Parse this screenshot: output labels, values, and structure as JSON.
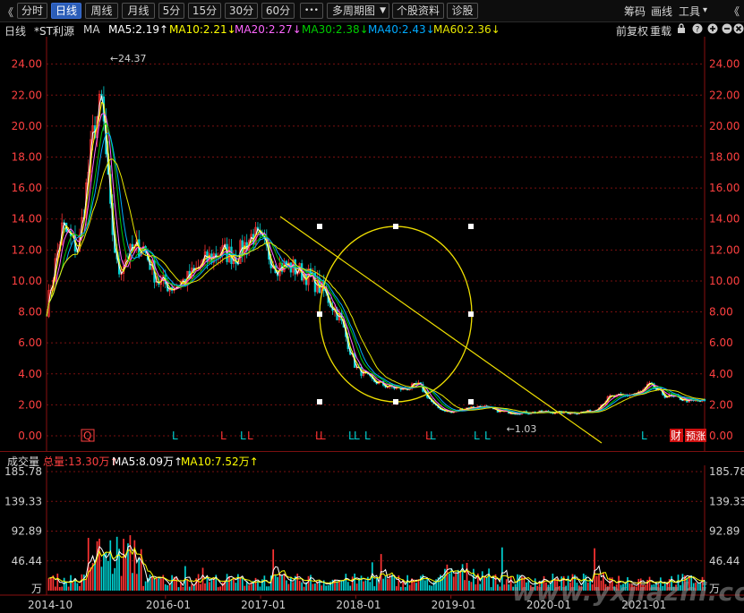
{
  "toolbar": {
    "back_glyph": "《",
    "tabs": [
      "分时",
      "日线",
      "周线",
      "月线",
      "5分",
      "15分",
      "30分",
      "60分"
    ],
    "active_tab": "日线",
    "more_glyph": "•••",
    "multi_period": "多周期图",
    "stock_info": "个股资料",
    "diagnose": "诊股",
    "chips": "筹码",
    "draw": "画线",
    "tools": "工具",
    "tools_caret": "▾",
    "collapse_glyph": "《"
  },
  "info": {
    "period": "日线",
    "name": "*ST利源",
    "ma_label": "MA",
    "ma5": "MA5:2.19↑",
    "ma10": "MA10:2.21↓",
    "ma20": "MA20:2.27↓",
    "ma30": "MA30:2.38↓",
    "ma40": "MA40:2.43↓",
    "ma60": "MA60:2.36↓",
    "adjust": "前复权",
    "overlay": "重载"
  },
  "vol_info": {
    "title": "成交量",
    "total": "总量:13.30万↑",
    "ma5": "MA5:8.09万↑",
    "ma10": "MA10:7.52万↑",
    "unit": "万"
  },
  "colors": {
    "up": "#ff3333",
    "down": "#00d0d0",
    "ma5": "#ffffff",
    "ma10": "#ffff00",
    "ma20": "#ff66ff",
    "ma30": "#00cc00",
    "ma40": "#00aaff",
    "ma60": "#e8e800",
    "axis_text": "#ff4040",
    "annotation": "#f0e000"
  },
  "icons": {
    "lock": "lock-icon",
    "help": "help-icon",
    "zoom_in": "zoom-in-icon",
    "zoom_out": "zoom-out-icon",
    "close": "close-icon"
  },
  "markers": {
    "q": "Q",
    "finance": "财",
    "limit": "预涨"
  },
  "chart_data": [
    {
      "type": "line",
      "title": "",
      "subtitle": "",
      "x_ticks": [
        "2014-10",
        "2016-01",
        "2017-01",
        "2018-01",
        "2019-01",
        "2020-01",
        "2021-01"
      ],
      "y_ticks": [
        "24.00",
        "22.00",
        "20.00",
        "18.00",
        "16.00",
        "14.00",
        "12.00",
        "10.00",
        "8.00",
        "6.00",
        "4.00",
        "2.00",
        "0.00"
      ],
      "ylim": [
        0,
        24.5
      ],
      "high_label": "24.37",
      "low_label": "1.03",
      "series": [
        {
          "name": "",
          "x": [
            "2014-10",
            "2014-12",
            "2015-02",
            "2015-04",
            "2015-05",
            "2015-06",
            "2015-07",
            "2015-08",
            "2015-10",
            "2015-12",
            "2016-02",
            "2016-04",
            "2016-06",
            "2016-08",
            "2016-10",
            "2016-12",
            "2017-01",
            "2017-03",
            "2017-05",
            "2017-07",
            "2017-09",
            "2017-11",
            "2018-01",
            "2018-03",
            "2018-05",
            "2018-07",
            "2018-09",
            "2018-11",
            "2019-01",
            "2019-03",
            "2019-05",
            "2019-07",
            "2019-09",
            "2019-11",
            "2020-01",
            "2020-03",
            "2020-05",
            "2020-07",
            "2020-09",
            "2020-11",
            "2021-01",
            "2021-02",
            "2021-04",
            "2021-06",
            "2021-07"
          ],
          "y": [
            8.2,
            13.5,
            12.0,
            20.0,
            21.5,
            14.5,
            10.5,
            11.5,
            12.4,
            10.0,
            9.6,
            10.2,
            11.3,
            11.9,
            11.6,
            13.0,
            12.5,
            11.0,
            10.9,
            10.3,
            9.3,
            7.6,
            4.4,
            3.6,
            3.2,
            3.0,
            3.3,
            1.9,
            1.5,
            1.8,
            1.9,
            1.6,
            1.5,
            1.5,
            1.55,
            1.5,
            1.5,
            1.6,
            2.5,
            2.6,
            2.8,
            3.3,
            2.6,
            2.4,
            2.25
          ]
        }
      ]
    },
    {
      "type": "bar",
      "title": "",
      "y_ticks": [
        "185.78",
        "139.33",
        "92.89",
        "46.44"
      ],
      "ylim": [
        0,
        185.78
      ],
      "ma5_label": "MA5",
      "ma10_label": "MA10"
    }
  ]
}
